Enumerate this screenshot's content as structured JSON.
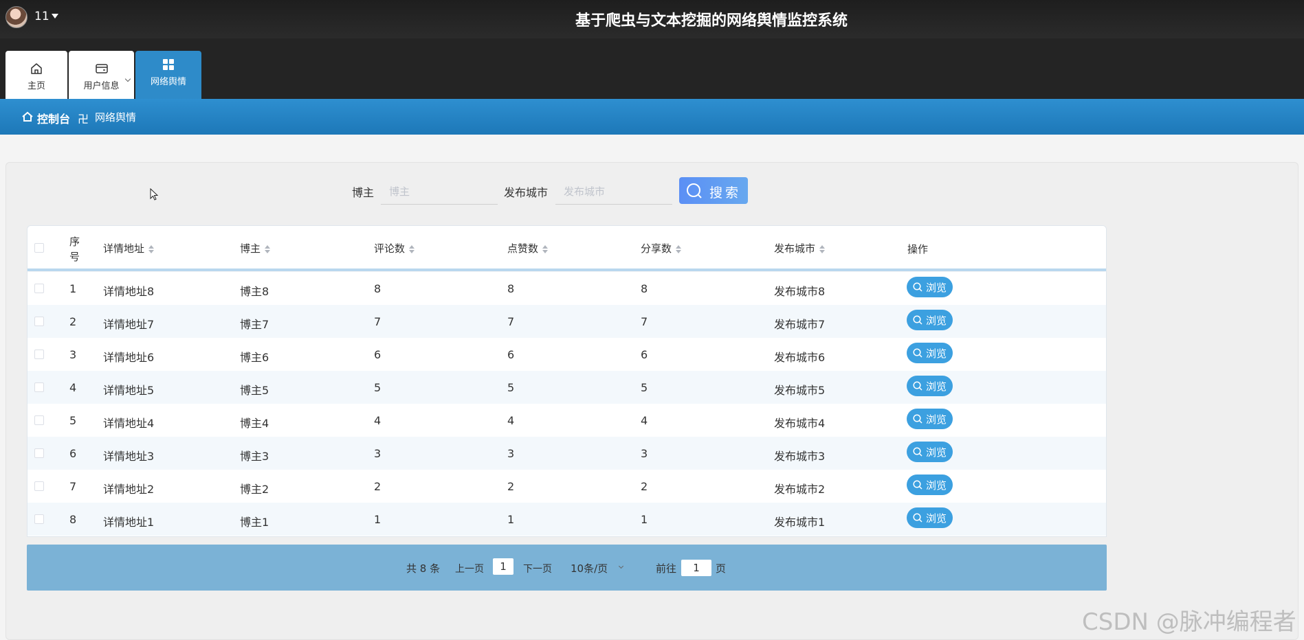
{
  "header": {
    "user_name": "11",
    "app_title": "基于爬虫与文本挖掘的网络舆情监控系统"
  },
  "nav": {
    "tabs": [
      {
        "label": "主页",
        "icon": "home-icon"
      },
      {
        "label": "用户信息",
        "icon": "wallet-icon"
      },
      {
        "label": "网络舆情",
        "icon": "grid-icon"
      }
    ]
  },
  "breadcrumb": {
    "home": "控制台",
    "separator": "卍",
    "current": "网络舆情"
  },
  "search": {
    "author_label": "博主",
    "author_placeholder": "博主",
    "city_label": "发布城市",
    "city_placeholder": "发布城市",
    "button_label": "搜索"
  },
  "table": {
    "columns": [
      "序号",
      "详情地址",
      "博主",
      "评论数",
      "点赞数",
      "分享数",
      "发布城市",
      "操作"
    ],
    "action_label": "浏览",
    "rows": [
      {
        "index": "1",
        "url": "详情地址8",
        "author": "博主8",
        "comments": "8",
        "likes": "8",
        "shares": "8",
        "city": "发布城市8"
      },
      {
        "index": "2",
        "url": "详情地址7",
        "author": "博主7",
        "comments": "7",
        "likes": "7",
        "shares": "7",
        "city": "发布城市7"
      },
      {
        "index": "3",
        "url": "详情地址6",
        "author": "博主6",
        "comments": "6",
        "likes": "6",
        "shares": "6",
        "city": "发布城市6"
      },
      {
        "index": "4",
        "url": "详情地址5",
        "author": "博主5",
        "comments": "5",
        "likes": "5",
        "shares": "5",
        "city": "发布城市5"
      },
      {
        "index": "5",
        "url": "详情地址4",
        "author": "博主4",
        "comments": "4",
        "likes": "4",
        "shares": "4",
        "city": "发布城市4"
      },
      {
        "index": "6",
        "url": "详情地址3",
        "author": "博主3",
        "comments": "3",
        "likes": "3",
        "shares": "3",
        "city": "发布城市3"
      },
      {
        "index": "7",
        "url": "详情地址2",
        "author": "博主2",
        "comments": "2",
        "likes": "2",
        "shares": "2",
        "city": "发布城市2"
      },
      {
        "index": "8",
        "url": "详情地址1",
        "author": "博主1",
        "comments": "1",
        "likes": "1",
        "shares": "1",
        "city": "发布城市1"
      }
    ]
  },
  "pagination": {
    "total": "共 8 条",
    "prev": "上一页",
    "current_page": "1",
    "next": "下一页",
    "page_size": "10条/页",
    "goto_prefix": "前往",
    "goto_value": "1",
    "goto_suffix": "页"
  },
  "watermark": "CSDN @脉冲编程者",
  "colors": {
    "accent": "#2e8bc9",
    "pager_bg": "#7bb2d6",
    "action_button": "#3ca0e0",
    "search_button": "#5b8ff5"
  }
}
